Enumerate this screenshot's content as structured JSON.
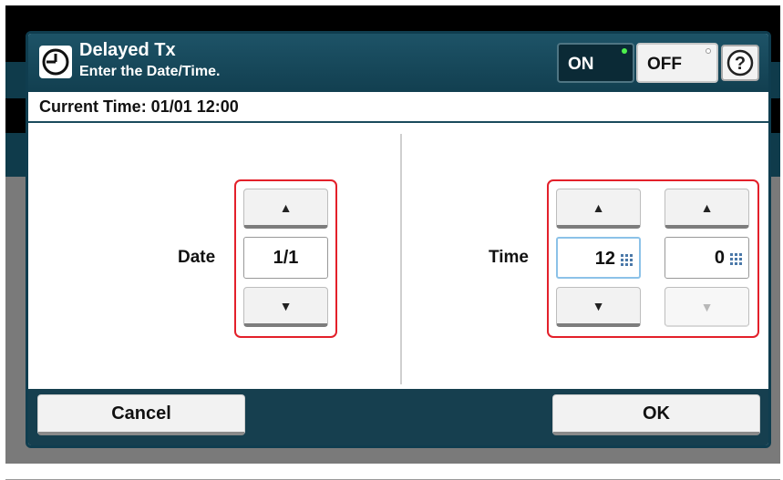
{
  "header": {
    "title": "Delayed Tx",
    "subtitle": "Enter the Date/Time.",
    "on_label": "ON",
    "off_label": "OFF",
    "help_glyph": "?",
    "clock_icon": "clock-icon"
  },
  "current_time": {
    "label": "Current Time:  01/01 12:00"
  },
  "date": {
    "label": "Date",
    "value": "1/1",
    "up_glyph": "▲",
    "down_glyph": "▼"
  },
  "time": {
    "label": "Time",
    "hour_value": "12",
    "minute_value": "0",
    "up_glyph": "▲",
    "down_glyph": "▼"
  },
  "footer": {
    "cancel_label": "Cancel",
    "ok_label": "OK"
  },
  "colors": {
    "header_bg": "#1d5367",
    "footer_bg": "#163f4f",
    "highlight": "#e3202a",
    "on_led": "#4df04d",
    "selected_border": "#8cc2e8"
  }
}
